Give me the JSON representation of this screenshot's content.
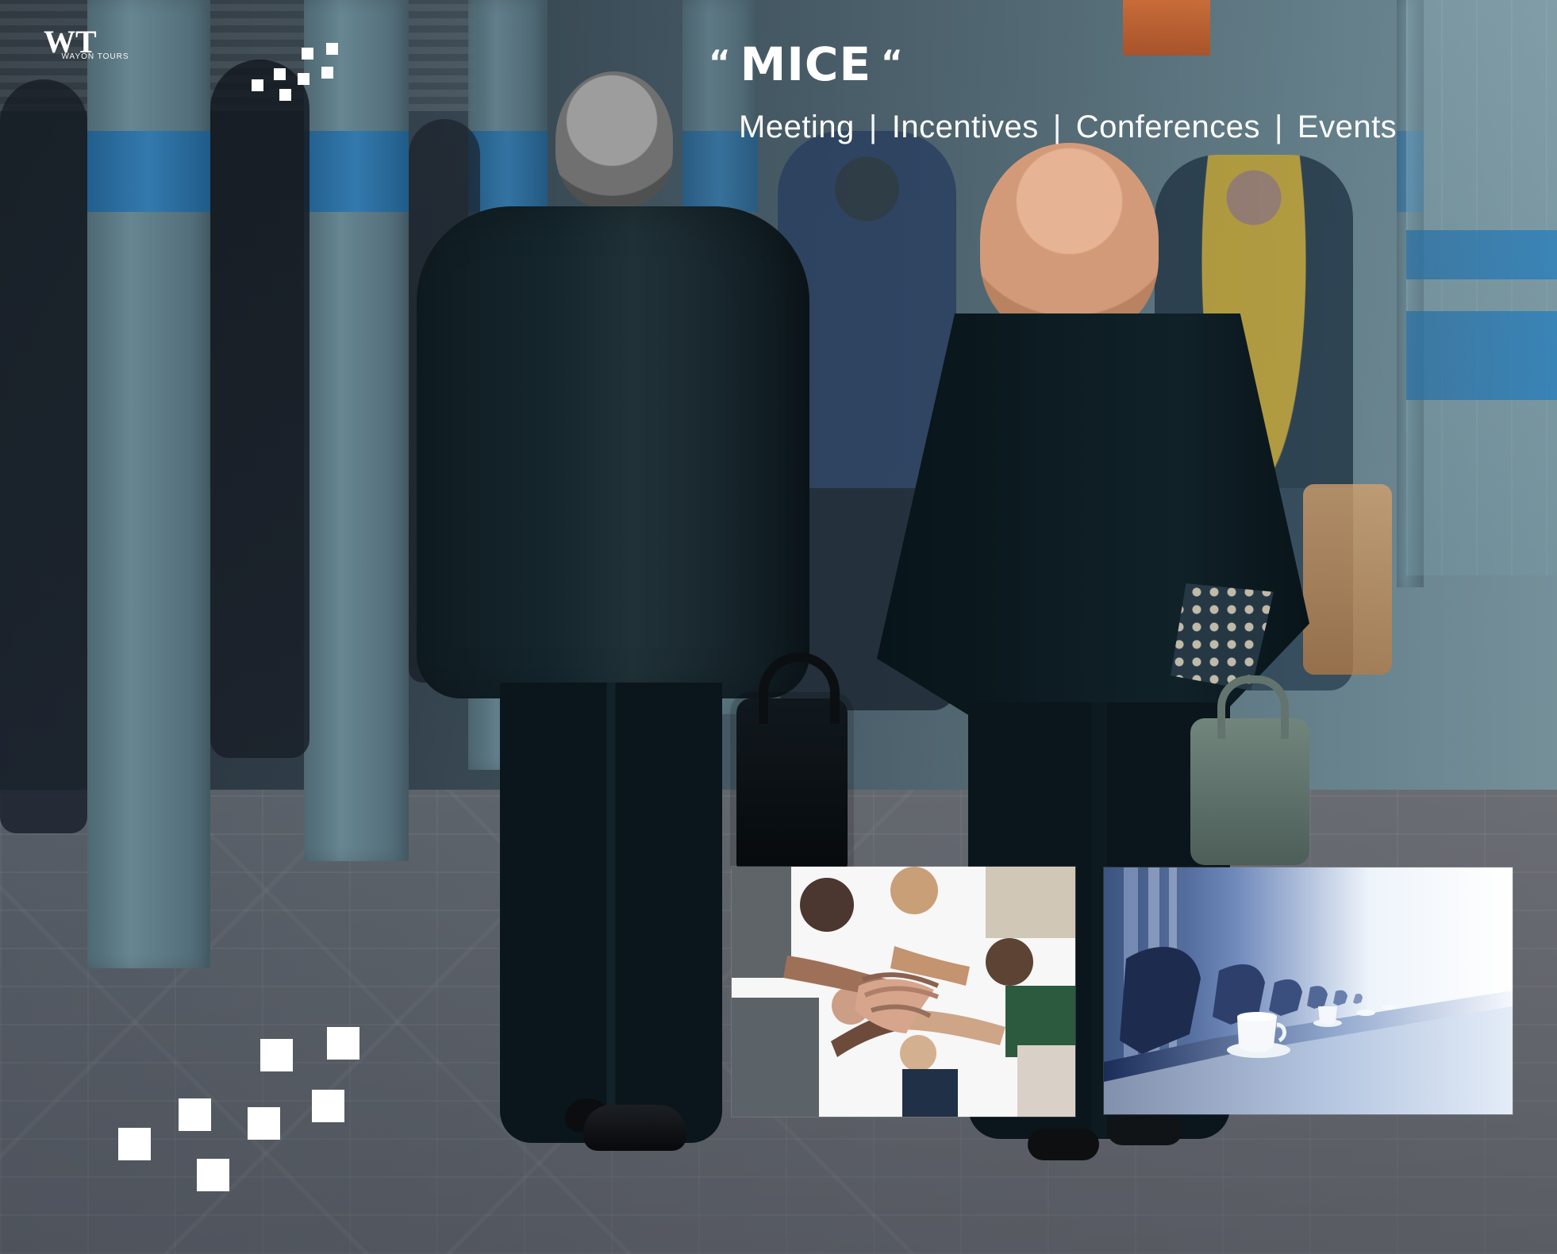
{
  "brand": {
    "logo_mark": "WT",
    "logo_text": "WAYON TOURS"
  },
  "hero": {
    "open_quote": "“",
    "title": "MICE",
    "close_quote": "“",
    "services": [
      "Meeting",
      "Incentives",
      "Conferences",
      "Events"
    ],
    "separator": "|"
  },
  "photos": {
    "left_inset_icon": "team-hands-photo",
    "right_inset_icon": "meeting-room-photo"
  },
  "colors": {
    "text": "#ffffff",
    "accent_blue": "#2f79b0",
    "accent_orange": "#d96b2e"
  }
}
